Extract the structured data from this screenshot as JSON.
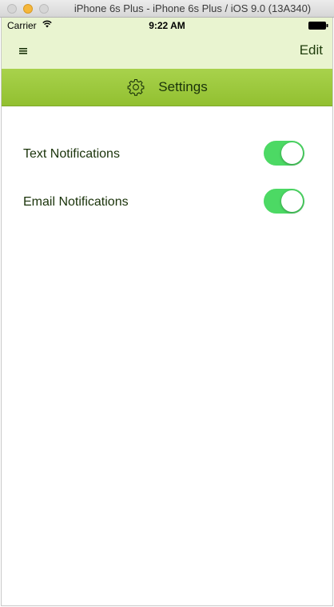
{
  "window": {
    "title": "iPhone 6s Plus - iPhone 6s Plus / iOS 9.0 (13A340)"
  },
  "status_bar": {
    "carrier": "Carrier",
    "time": "9:22 AM",
    "wifi_icon": "wifi-icon",
    "battery_icon": "battery-full-icon"
  },
  "nav_bar": {
    "menu_icon": "hamburger-menu-icon",
    "edit_label": "Edit"
  },
  "header": {
    "icon": "gear-icon",
    "title": "Settings"
  },
  "settings": [
    {
      "label": "Text Notifications",
      "enabled": true
    },
    {
      "label": "Email Notifications",
      "enabled": true
    }
  ],
  "colors": {
    "nav_background": "#e9f4d0",
    "header_green": "#9ccb3c",
    "toggle_on": "#4cd964",
    "text_dark_green": "#1a330a"
  }
}
